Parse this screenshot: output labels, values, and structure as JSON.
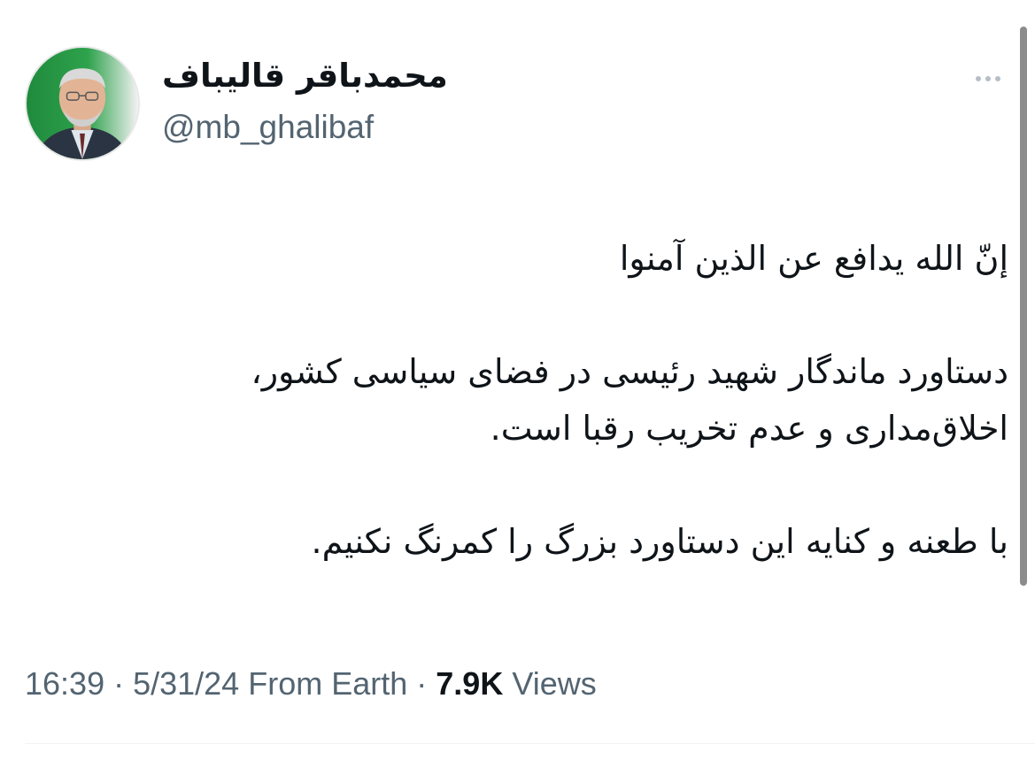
{
  "tweet": {
    "author": {
      "display_name": "محمدباقر قالیباف",
      "handle": "@mb_ghalibaf",
      "avatar": "profile-photo"
    },
    "more_icon": "more-horizontal-icon",
    "body": {
      "line1": "إنّ الله يدافع عن الذين آمنوا",
      "line2": "دستاورد ماندگار شهید رئیسی در فضای سیاسی کشور،",
      "line3": "اخلاق‌مداری و عدم تخریب رقبا است.",
      "line4": "با طعنه و کنایه این دستاورد بزرگ را کمرنگ نکنیم."
    },
    "meta": {
      "time": "16:39",
      "separator": " · ",
      "date": "5/31/24",
      "source": "From Earth",
      "views_count": "7.9K",
      "views_label": "Views"
    }
  }
}
